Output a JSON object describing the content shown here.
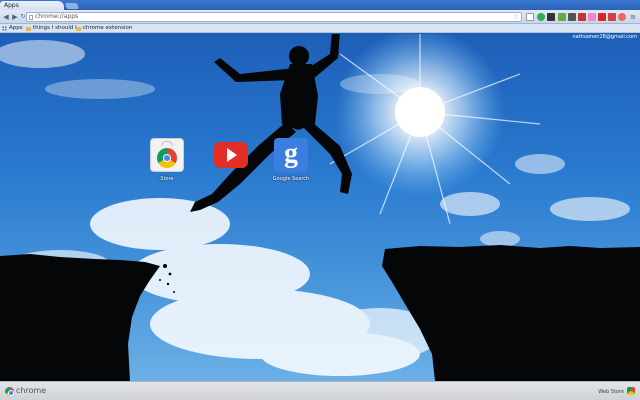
{
  "window": {
    "tab_title": "Apps"
  },
  "toolbar": {
    "url": "chrome://apps"
  },
  "bookmarks": {
    "apps_label": "Apps",
    "items": [
      "things I should l...",
      "chrome extension"
    ]
  },
  "content": {
    "signed_in_as": "nathuonen28@gmail.com",
    "apps": [
      {
        "name": "Store"
      },
      {
        "name": ""
      },
      {
        "name": "Google Search"
      }
    ]
  },
  "footer": {
    "brand": "chrome",
    "web_store": "Web Store"
  },
  "colors": {
    "sky_top": "#1d5fb8",
    "sky_bottom": "#6cb0e6",
    "youtube_red": "#e52d27",
    "google_blue": "#3b7de0"
  }
}
